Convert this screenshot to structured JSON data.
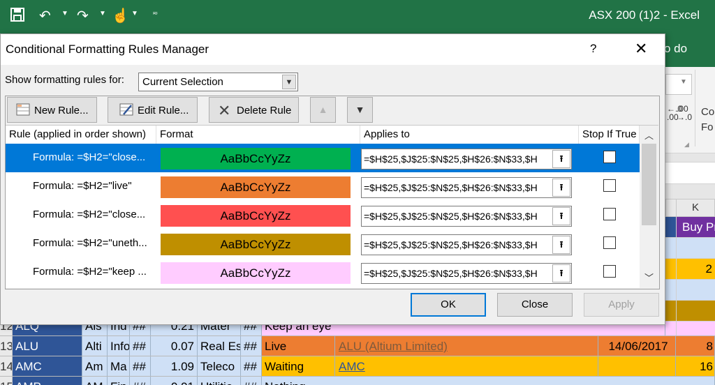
{
  "excel": {
    "qat": {
      "save_icon": "save-icon",
      "undo_icon": "undo-icon",
      "redo_icon": "redo-icon",
      "touch_icon": "touch-mode-icon",
      "customize_icon": "customize-icon"
    },
    "title": "ASX 200 (1)2  -  Excel",
    "tell_me": "o do",
    "ribbon": {
      "dec_inc": "←.0\n.00",
      "dec_dec": ".00\n→.0",
      "cond_text": "Co\nFo"
    },
    "col_k_header": "K",
    "right_cells": [
      "Buy Pr",
      "",
      "2",
      "",
      "",
      "",
      "8",
      "16",
      ""
    ],
    "rows": [
      {
        "num": "12",
        "ticker": "ALQ",
        "name": "Als",
        "sector_short": "Ind",
        "hash1": "##",
        "price": "0.21",
        "industry": "Mater",
        "hash2": "##",
        "status": "Keep an eye",
        "link": "",
        "date": "",
        "k": ""
      },
      {
        "num": "13",
        "ticker": "ALU",
        "name": "Alti",
        "sector_short": "Info",
        "hash1": "##",
        "price": "0.07",
        "industry": "Real Es",
        "hash2": "##",
        "status": "Live",
        "link": "ALU (Altium Limited)",
        "date": "14/06/2017",
        "k": "8"
      },
      {
        "num": "14",
        "ticker": "AMC",
        "name": "Am",
        "sector_short": "Ma",
        "hash1": "##",
        "price": "1.09",
        "industry": "Teleco",
        "hash2": "##",
        "status": "Waiting",
        "link": "AMC",
        "date": "",
        "k": "16"
      },
      {
        "num": "15",
        "ticker": "AMP",
        "name": "AM",
        "sector_short": "Fin",
        "hash1": "##",
        "price": "0.91",
        "industry": "Utilitie",
        "hash2": "##",
        "status": "Nothing",
        "link": "",
        "date": "",
        "k": ""
      }
    ]
  },
  "dialog": {
    "title": "Conditional Formatting Rules Manager",
    "help": "?",
    "close": "✕",
    "show_label": "Show formatting rules for:",
    "show_value": "Current Selection",
    "toolbar": {
      "new_rule": "New Rule...",
      "edit_rule": "Edit Rule...",
      "delete_rule": "Delete Rule",
      "move_up": "▲",
      "move_down": "▼"
    },
    "columns": {
      "rule": "Rule (applied in order shown)",
      "format": "Format",
      "applies_to": "Applies to",
      "stop_if_true": "Stop If True"
    },
    "rules": [
      {
        "description": "Formula: =$H2=\"close...",
        "preview": "AaBbCcYyZz",
        "color": "#00b050",
        "applies_to": "=$H$25,$J$25:$N$25,$H$26:$N$33,$H",
        "stop": false,
        "selected": true
      },
      {
        "description": "Formula: =$H2=\"live\"",
        "preview": "AaBbCcYyZz",
        "color": "#ed7d31",
        "applies_to": "=$H$25,$J$25:$N$25,$H$26:$N$33,$H",
        "stop": false,
        "selected": false
      },
      {
        "description": "Formula: =$H2=\"close...",
        "preview": "AaBbCcYyZz",
        "color": "#ff5050",
        "applies_to": "=$H$25,$J$25:$N$25,$H$26:$N$33,$H",
        "stop": false,
        "selected": false
      },
      {
        "description": "Formula: =$H2=\"uneth...",
        "preview": "AaBbCcYyZz",
        "color": "#bf8f00",
        "applies_to": "=$H$25,$J$25:$N$25,$H$26:$N$33,$H",
        "stop": false,
        "selected": false
      },
      {
        "description": "Formula: =$H2=\"keep ...",
        "preview": "AaBbCcYyZz",
        "color": "#ffccff",
        "applies_to": "=$H$25,$J$25:$N$25,$H$26:$N$33,$H",
        "stop": false,
        "selected": false
      }
    ],
    "buttons": {
      "ok": "OK",
      "close": "Close",
      "apply": "Apply"
    }
  }
}
